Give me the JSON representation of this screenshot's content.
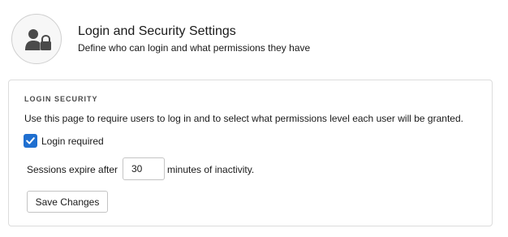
{
  "header": {
    "title": "Login and Security Settings",
    "subtitle": "Define who can login and what permissions they have",
    "icon": "user-lock-icon"
  },
  "login_security": {
    "section_title": "LOGIN SECURITY",
    "description": "Use this page to require users to log in and to select what permissions level each user will be granted.",
    "login_required": {
      "label": "Login required",
      "checked": true
    },
    "sessions": {
      "prefix": "Sessions expire after",
      "minutes_value": "30",
      "suffix": "minutes of inactivity."
    },
    "save_label": "Save Changes"
  },
  "colors": {
    "checkbox_accent": "#1f6fd0",
    "icon_fill": "#4a4a4a",
    "border": "#dcdcdc"
  }
}
